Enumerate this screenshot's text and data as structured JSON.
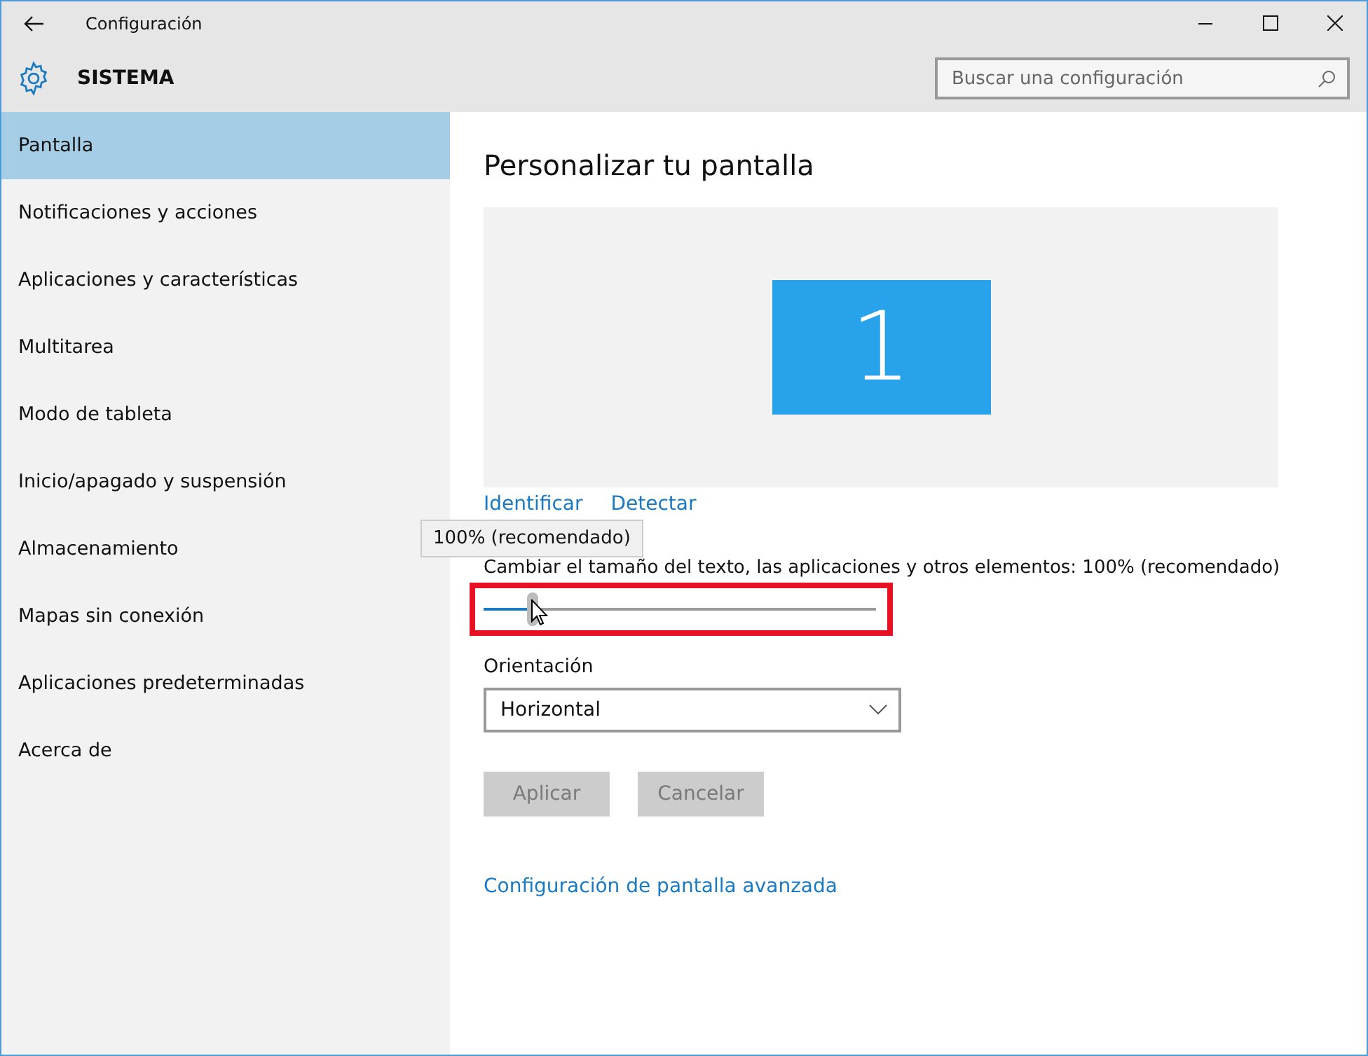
{
  "window": {
    "title": "Configuración"
  },
  "header": {
    "title": "SISTEMA",
    "search": {
      "placeholder": "Buscar una configuración"
    }
  },
  "sidebar": {
    "items": [
      {
        "label": "Pantalla",
        "selected": true
      },
      {
        "label": "Notificaciones y acciones",
        "selected": false
      },
      {
        "label": "Aplicaciones y características",
        "selected": false
      },
      {
        "label": "Multitarea",
        "selected": false
      },
      {
        "label": "Modo de tableta",
        "selected": false
      },
      {
        "label": "Inicio/apagado y suspensión",
        "selected": false
      },
      {
        "label": "Almacenamiento",
        "selected": false
      },
      {
        "label": "Mapas sin conexión",
        "selected": false
      },
      {
        "label": "Aplicaciones predeterminadas",
        "selected": false
      },
      {
        "label": "Acerca de",
        "selected": false
      }
    ]
  },
  "main": {
    "title": "Personalizar tu pantalla",
    "monitor": {
      "number": "1"
    },
    "links": [
      "Identificar",
      "Detectar"
    ],
    "scale": {
      "tooltip": "100% (recomendado)",
      "label": "Cambiar el tamaño del texto, las aplicaciones y otros elementos: 100% (recomendado)",
      "level": 0.125
    },
    "orientation": {
      "label": "Orientación",
      "value": "Horizontal"
    },
    "buttons": [
      {
        "label": "Aplicar",
        "disabled": true
      },
      {
        "label": "Cancelar",
        "disabled": true
      }
    ],
    "advanced_link": "Configuración de pantalla avanzada"
  }
}
